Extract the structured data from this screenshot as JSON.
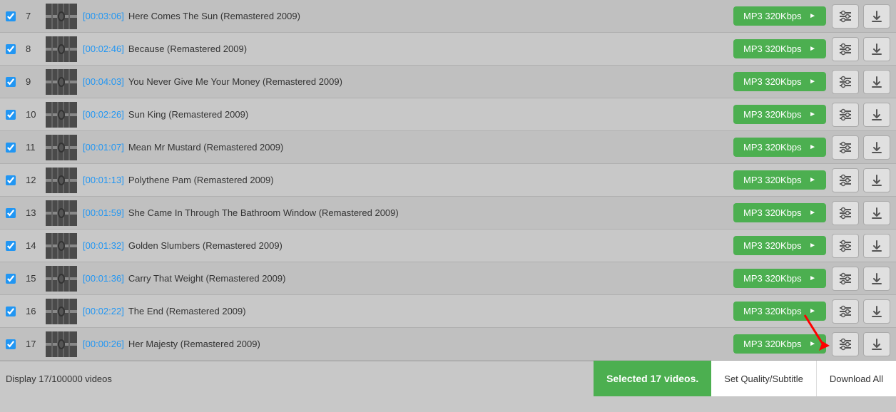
{
  "tracks": [
    {
      "num": 7,
      "duration": "[00:03:06]",
      "title": "Here Comes The Sun (Remastered 2009)",
      "format": "MP3 320Kbps",
      "checked": true
    },
    {
      "num": 8,
      "duration": "[00:02:46]",
      "title": "Because (Remastered 2009)",
      "format": "MP3 320Kbps",
      "checked": true
    },
    {
      "num": 9,
      "duration": "[00:04:03]",
      "title": "You Never Give Me Your Money (Remastered 2009)",
      "format": "MP3 320Kbps",
      "checked": true
    },
    {
      "num": 10,
      "duration": "[00:02:26]",
      "title": "Sun King (Remastered 2009)",
      "format": "MP3 320Kbps",
      "checked": true
    },
    {
      "num": 11,
      "duration": "[00:01:07]",
      "title": "Mean Mr Mustard (Remastered 2009)",
      "format": "MP3 320Kbps",
      "checked": true
    },
    {
      "num": 12,
      "duration": "[00:01:13]",
      "title": "Polythene Pam (Remastered 2009)",
      "format": "MP3 320Kbps",
      "checked": true
    },
    {
      "num": 13,
      "duration": "[00:01:59]",
      "title": "She Came In Through The Bathroom Window (Remastered 2009)",
      "format": "MP3 320Kbps",
      "checked": true
    },
    {
      "num": 14,
      "duration": "[00:01:32]",
      "title": "Golden Slumbers (Remastered 2009)",
      "format": "MP3 320Kbps",
      "checked": true
    },
    {
      "num": 15,
      "duration": "[00:01:36]",
      "title": "Carry That Weight (Remastered 2009)",
      "format": "MP3 320Kbps",
      "checked": true
    },
    {
      "num": 16,
      "duration": "[00:02:22]",
      "title": "The End (Remastered 2009)",
      "format": "MP3 320Kbps",
      "checked": true
    },
    {
      "num": 17,
      "duration": "[00:00:26]",
      "title": "Her Majesty (Remastered 2009)",
      "format": "MP3 320Kbps",
      "checked": true
    }
  ],
  "footer": {
    "display_text": "Display 17/100000 videos",
    "selected_label": "Selected 17 videos.",
    "set_quality_label": "Set Quality/Subtitle",
    "download_all_label": "Download All"
  }
}
